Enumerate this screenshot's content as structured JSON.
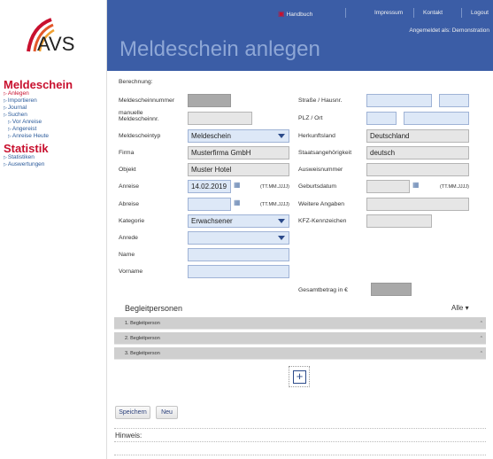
{
  "sidebar": {
    "logo_text": "AVS",
    "sections": [
      {
        "title": "Meldeschein"
      },
      {
        "title": "Statistik"
      }
    ],
    "items": [
      {
        "label": "Anlegen"
      },
      {
        "label": "Importieren"
      },
      {
        "label": "Journal"
      },
      {
        "label": "Suchen"
      },
      {
        "label": "Vor Anreise"
      },
      {
        "label": "Angereist"
      },
      {
        "label": "Anreise Heute"
      },
      {
        "label": "Statistiken"
      },
      {
        "label": "Auswertungen"
      }
    ]
  },
  "header": {
    "handbuch": "Handbuch",
    "impressum": "Impressum",
    "kontakt": "Kontakt",
    "logout": "Logout",
    "angemeldet": "Angemeldet als: Demonstration",
    "title": "Meldeschein anlegen"
  },
  "form": {
    "berechnung": "Berechnung:",
    "left": {
      "meldescheinnummer": "Meldescheinnummer",
      "manuelle": "manuelle Meldescheinnr.",
      "meldescheintyp": "Meldescheintyp",
      "meldescheintyp_value": "Meldeschein",
      "firma": "Firma",
      "firma_value": "Musterfirma GmbH",
      "objekt": "Objekt",
      "objekt_value": "Muster Hotel",
      "anreise": "Anreise",
      "anreise_value": "14.02.2019",
      "abreise": "Abreise",
      "abreise_value": "",
      "kategorie": "Kategorie",
      "kategorie_value": "Erwachsener",
      "anrede": "Anrede",
      "anrede_value": "",
      "name": "Name",
      "vorname": "Vorname",
      "date_format": "(TT.MM.JJJJ)"
    },
    "right": {
      "strasse": "Straße / Hausnr.",
      "plz": "PLZ / Ort",
      "herkunftsland": "Herkunftsland",
      "herkunftsland_value": "Deutschland",
      "staatsangehoerigkeit": "Staatsangehörigkeit",
      "staatsangehoerigkeit_value": "deutsch",
      "ausweisnummer": "Ausweisnummer",
      "geburtsdatum": "Geburtsdatum",
      "weitere": "Weitere Angaben",
      "kfz": "KFZ-Kennzeichen",
      "date_format": "(TT.MM.JJJJ)"
    },
    "gesamtbetrag": "Gesamtbetrag in €"
  },
  "begleit": {
    "title": "Begleitpersonen",
    "alle": "Alle ▾",
    "rows": [
      "1. Begleitperson",
      "2. Begleitperson",
      "3. Begleitperson"
    ]
  },
  "buttons": {
    "speichern": "Speichern",
    "neu": "Neu",
    "add": "+"
  },
  "hinweis": "Hinweis:",
  "colors": {
    "header_bg": "#3b5da6",
    "accent_red": "#c8102e",
    "field_blue": "#dde8f7"
  }
}
